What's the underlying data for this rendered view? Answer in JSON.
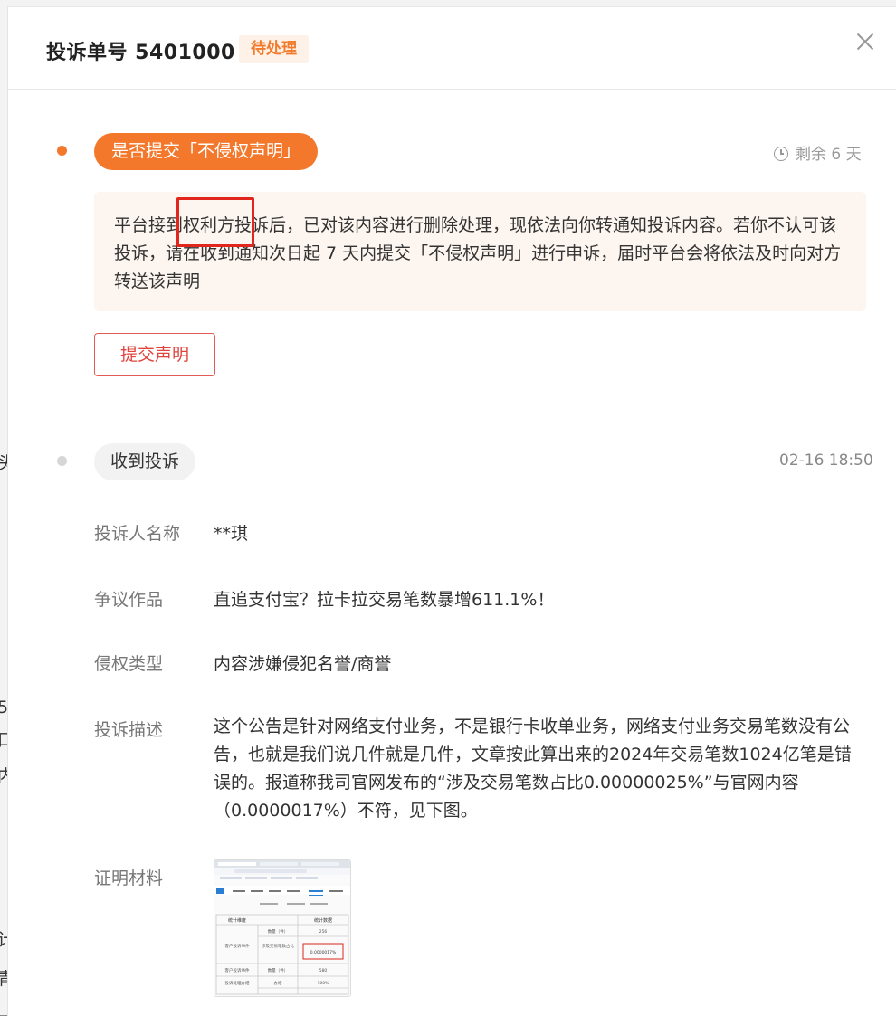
{
  "header": {
    "title": "投诉单号 5401000",
    "status": "待处理"
  },
  "step1": {
    "title": "是否提交「不侵权声明」",
    "remaining": "剩余 6 天",
    "notice": "平台接到权利方投诉后，已对该内容进行删除处理，现依法向你转通知投诉内容。若你不认可该投诉，请在收到通知次日起 7 天内提交「不侵权声明」进行申诉，届时平台会将依法及时向对方转送该声明",
    "button": "提交声明"
  },
  "step2": {
    "title": "收到投诉",
    "time": "02-16 18:50"
  },
  "details": {
    "complainant_label": "投诉人名称",
    "complainant_value": "**琪",
    "work_label": "争议作品",
    "work_value": "直追支付宝？拉卡拉交易笔数暴增611.1%！",
    "type_label": "侵权类型",
    "type_value": "内容涉嫌侵犯名誉/商誉",
    "desc_label": "投诉描述",
    "desc_value": "这个公告是针对网络支付业务，不是银行卡收单业务，网络支付业务交易笔数没有公告，也就是我们说几件就是几件，文章按此算出来的2024年交易笔数1024亿笔是错误的。报道称我司官网发布的“涉及交易笔数占比0.00000025%”与官网内容（0.0000017%）不符，见下图。",
    "evidence_label": "证明材料"
  },
  "evidence_image": {
    "col1_header": "统计维度",
    "col2_header": "统计数据",
    "row_a_label": "客户投诉事件",
    "row_a1_metric": "数量（件）",
    "row_a1_value": "256",
    "row_a2_metric": "涉及交易笔数占比",
    "row_a2_value": "0.0000017%",
    "row_b_label": "客户投诉事件",
    "row_b_metric": "数量（件）",
    "row_b_value": "580",
    "row_c_label": "投诉处理办结",
    "row_c_metric": "办结",
    "row_c_value": "100%"
  },
  "colors": {
    "accent": "#f3782b",
    "badge_bg": "#fdf1e8",
    "notice_bg": "#fdf5ef",
    "highlight": "#e0261d"
  }
}
